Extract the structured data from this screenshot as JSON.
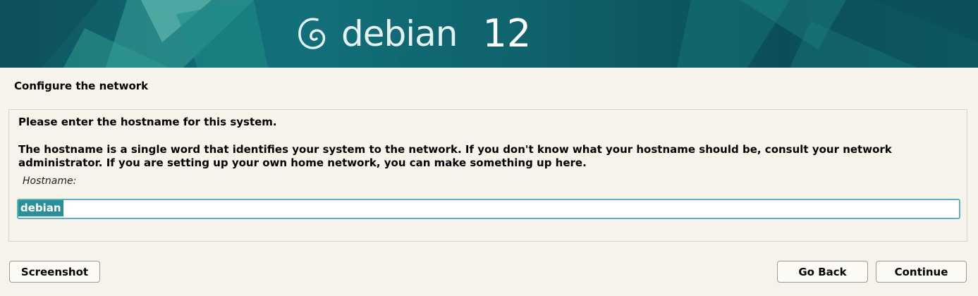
{
  "header": {
    "logo_icon": "debian-swirl-icon",
    "brand_name": "debian",
    "version": "12"
  },
  "step": {
    "title": "Configure the network"
  },
  "form": {
    "prompt": "Please enter the hostname for this system.",
    "description": "The hostname is a single word that identifies your system to the network. If you don't know what your hostname should be, consult your network administrator. If you are setting up your own home network, you can make something up here.",
    "field_label": "Hostname:",
    "hostname_value": "debian"
  },
  "buttons": {
    "screenshot": "Screenshot",
    "go_back": "Go Back",
    "continue": "Continue"
  },
  "colors": {
    "banner_teal": "#12707a",
    "input_focus": "#5fb3b8",
    "selection": "#2a8f96",
    "background": "#f6f4ea"
  }
}
